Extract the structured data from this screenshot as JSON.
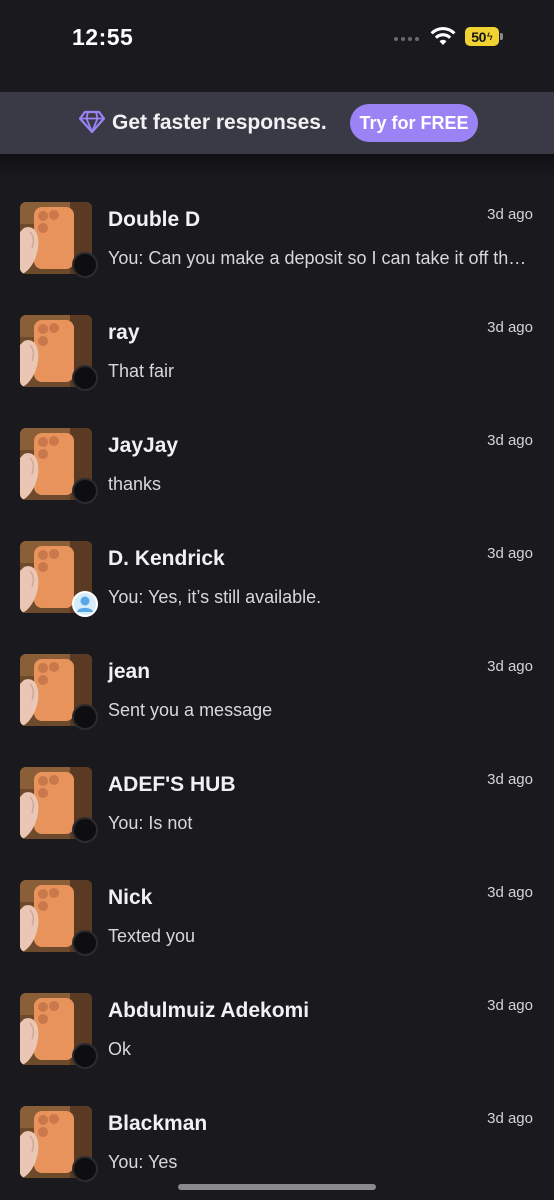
{
  "status_bar": {
    "time": "12:55",
    "battery": "50"
  },
  "promo": {
    "icon": "diamond-icon",
    "text": "Get faster responses.",
    "button": "Try for FREE",
    "accent": "#9b83f6"
  },
  "conversations": [
    {
      "name": "Double D",
      "time": "3d ago",
      "preview": "You: Can you make a deposit so I can take it off the market",
      "status": "dark"
    },
    {
      "name": "ray",
      "time": "3d ago",
      "preview": "That fair",
      "status": "dark"
    },
    {
      "name": "JayJay",
      "time": "3d ago",
      "preview": "thanks",
      "status": "dark"
    },
    {
      "name": "D. Kendrick",
      "time": "3d ago",
      "preview": "You: Yes, it’s still available.",
      "status": "user"
    },
    {
      "name": "jean",
      "time": "3d ago",
      "preview": "Sent you a message",
      "status": "dark"
    },
    {
      "name": "ADEF'S HUB",
      "time": "3d ago",
      "preview": "You: Is not",
      "status": "dark"
    },
    {
      "name": "Nick",
      "time": "3d ago",
      "preview": "Texted you",
      "status": "dark"
    },
    {
      "name": "Abdulmuiz Adekomi",
      "time": "3d ago",
      "preview": "Ok",
      "status": "dark"
    },
    {
      "name": "Blackman",
      "time": "3d ago",
      "preview": "You: Yes",
      "status": "dark"
    }
  ]
}
